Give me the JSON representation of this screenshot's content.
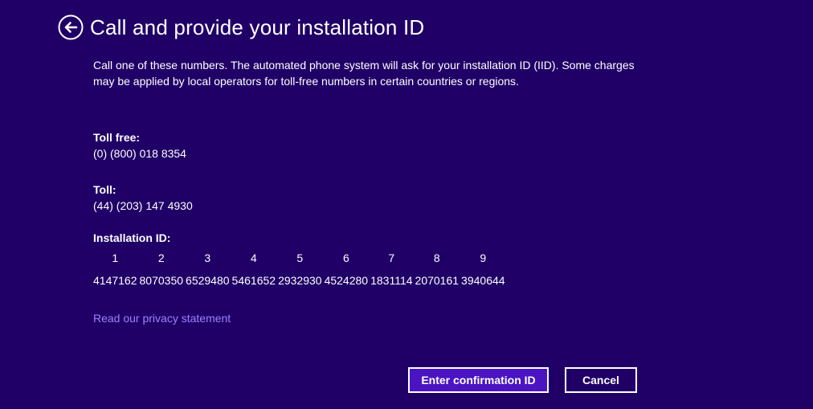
{
  "header": {
    "back_icon": "arrow-left-circle-icon",
    "title": "Call and provide your installation ID"
  },
  "description": "Call one of these numbers. The automated phone system will ask for your installation ID (IID). Some charges may be applied by local operators for toll-free numbers in certain countries or regions.",
  "toll_free": {
    "label": "Toll free:",
    "number": "(0) (800) 018 8354"
  },
  "toll": {
    "label": "Toll:",
    "number": "(44) (203) 147 4930"
  },
  "installation_id": {
    "label": "Installation ID:",
    "groups": [
      {
        "index": "1",
        "value": "4147162"
      },
      {
        "index": "2",
        "value": "8070350"
      },
      {
        "index": "3",
        "value": "6529480"
      },
      {
        "index": "4",
        "value": "5461652"
      },
      {
        "index": "5",
        "value": "2932930"
      },
      {
        "index": "6",
        "value": "4524280"
      },
      {
        "index": "7",
        "value": "1831114"
      },
      {
        "index": "8",
        "value": "2070161"
      },
      {
        "index": "9",
        "value": "3940644"
      }
    ]
  },
  "privacy_link": "Read our privacy statement",
  "buttons": {
    "enter_confirmation": "Enter confirmation ID",
    "cancel": "Cancel"
  },
  "colors": {
    "background": "#200067",
    "link": "#9b82ff",
    "primary_button": "#4a14c2",
    "text": "#ffffff"
  }
}
